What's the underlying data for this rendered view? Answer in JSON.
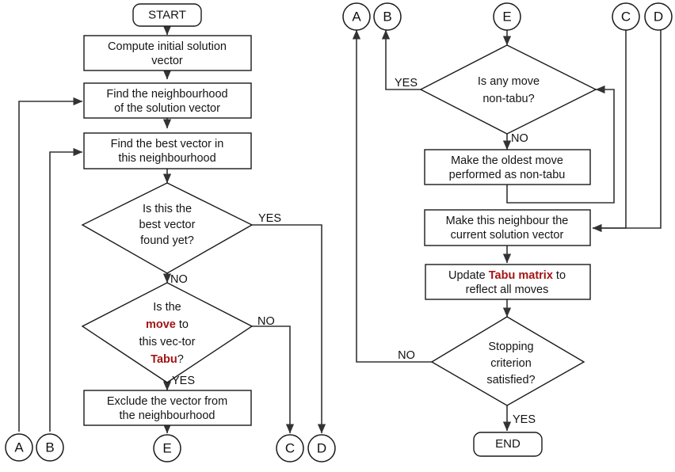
{
  "diagram": {
    "title": "Tabu Search Algorithm Flowchart",
    "accent_color": "#A31515",
    "text_color": "#151515",
    "line_color": "#333333",
    "background": "#ffffff"
  },
  "left_column": {
    "start": {
      "label": "START"
    },
    "compute_initial": {
      "line1": "Compute initial  solution",
      "line2": "vector"
    },
    "find_neighbourhood": {
      "line1": "Find the neighbourhood",
      "line2": "of the  solution vector"
    },
    "find_best_vector": {
      "line1": "Find the best vector in",
      "line2": "this neighbourhood"
    },
    "best_found_decision": {
      "line1": "Is this the",
      "line2": "best vector",
      "line3": "found yet?"
    },
    "tabu_decision": {
      "line1": "Is the",
      "line2_kw": "move",
      "line2_rest": " to",
      "line3": "this vec-tor",
      "line4_kw": "Tabu",
      "line4_rest": "?"
    },
    "exclude_vector": {
      "line1": "Exclude the vector from",
      "line2": "the neighbourhood"
    },
    "labels": {
      "best_yes": "YES",
      "best_no": "NO",
      "tabu_no": "NO",
      "tabu_yes": "YES"
    },
    "connectors_in": [
      {
        "id": "A",
        "label": "A"
      },
      {
        "id": "B",
        "label": "B"
      }
    ],
    "connectors_out": [
      {
        "id": "E",
        "label": "E"
      },
      {
        "id": "C",
        "label": "C"
      },
      {
        "id": "D",
        "label": "D"
      }
    ]
  },
  "right_column": {
    "connectors_in": [
      {
        "id": "E",
        "label": "E"
      },
      {
        "id": "C",
        "label": "C"
      },
      {
        "id": "D",
        "label": "D"
      }
    ],
    "connectors_out": [
      {
        "id": "A",
        "label": "A"
      },
      {
        "id": "B",
        "label": "B"
      }
    ],
    "non_tabu_decision": {
      "line1": "Is any move",
      "line2": "non-tabu?"
    },
    "oldest_move": {
      "line1": "Make the oldest move",
      "line2": "performed as non-tabu"
    },
    "make_neighbour": {
      "line1": "Make this neighbour the",
      "line2": "current solution vector"
    },
    "update_tabu": {
      "line1_pre": "Update ",
      "line1_kw": "Tabu matrix",
      "line1_post": " to",
      "line2": "reflect all moves"
    },
    "stopping_decision": {
      "line1": "Stopping",
      "line2": "criterion",
      "line3": "satisfied?"
    },
    "end": {
      "label": "END"
    },
    "labels": {
      "nontabu_yes": "YES",
      "nontabu_no": "NO",
      "stopping_no": "NO",
      "stopping_yes": "YES"
    }
  },
  "chart_data": {
    "type": "diagram",
    "diagram_kind": "flowchart",
    "nodes": [
      {
        "id": "start",
        "shape": "terminator",
        "text": "START",
        "column": "left"
      },
      {
        "id": "compute_initial",
        "shape": "process",
        "text": "Compute initial solution vector",
        "column": "left"
      },
      {
        "id": "find_neighbourhood",
        "shape": "process",
        "text": "Find the neighbourhood of the solution vector",
        "column": "left"
      },
      {
        "id": "find_best",
        "shape": "process",
        "text": "Find the best vector in this neighbourhood",
        "column": "left"
      },
      {
        "id": "best_found",
        "shape": "decision",
        "text": "Is this the best vector found yet?",
        "column": "left"
      },
      {
        "id": "is_tabu",
        "shape": "decision",
        "text": "Is the move to this vec-tor Tabu?",
        "column": "left"
      },
      {
        "id": "exclude",
        "shape": "process",
        "text": "Exclude the vector from the neighbourhood",
        "column": "left"
      },
      {
        "id": "non_tabu",
        "shape": "decision",
        "text": "Is any move non-tabu?",
        "column": "right"
      },
      {
        "id": "oldest_move",
        "shape": "process",
        "text": "Make the oldest move performed as non-tabu",
        "column": "right"
      },
      {
        "id": "make_neighbour",
        "shape": "process",
        "text": "Make this neighbour the current solution vector",
        "column": "right"
      },
      {
        "id": "update_tabu",
        "shape": "process",
        "text": "Update Tabu matrix to reflect all moves",
        "column": "right"
      },
      {
        "id": "stopping",
        "shape": "decision",
        "text": "Stopping criterion satisfied?",
        "column": "right"
      },
      {
        "id": "end",
        "shape": "terminator",
        "text": "END",
        "column": "right"
      },
      {
        "id": "A",
        "shape": "connector",
        "text": "A"
      },
      {
        "id": "B",
        "shape": "connector",
        "text": "B"
      },
      {
        "id": "C",
        "shape": "connector",
        "text": "C"
      },
      {
        "id": "D",
        "shape": "connector",
        "text": "D"
      },
      {
        "id": "E",
        "shape": "connector",
        "text": "E"
      }
    ],
    "edges": [
      {
        "from": "start",
        "to": "compute_initial",
        "label": ""
      },
      {
        "from": "compute_initial",
        "to": "find_neighbourhood",
        "label": ""
      },
      {
        "from": "find_neighbourhood",
        "to": "find_best",
        "label": ""
      },
      {
        "from": "find_best",
        "to": "best_found",
        "label": ""
      },
      {
        "from": "best_found",
        "to": "D",
        "label": "YES"
      },
      {
        "from": "best_found",
        "to": "is_tabu",
        "label": "NO"
      },
      {
        "from": "is_tabu",
        "to": "C",
        "label": "NO"
      },
      {
        "from": "is_tabu",
        "to": "exclude",
        "label": "YES"
      },
      {
        "from": "exclude",
        "to": "E",
        "label": ""
      },
      {
        "from": "E",
        "to": "non_tabu",
        "label": ""
      },
      {
        "from": "non_tabu",
        "to": "B",
        "label": "YES"
      },
      {
        "from": "non_tabu",
        "to": "oldest_move",
        "label": "NO"
      },
      {
        "from": "oldest_move",
        "to": "non_tabu",
        "label": ""
      },
      {
        "from": "C",
        "to": "make_neighbour",
        "label": ""
      },
      {
        "from": "D",
        "to": "make_neighbour",
        "label": ""
      },
      {
        "from": "make_neighbour",
        "to": "update_tabu",
        "label": ""
      },
      {
        "from": "update_tabu",
        "to": "stopping",
        "label": ""
      },
      {
        "from": "stopping",
        "to": "A",
        "label": "NO"
      },
      {
        "from": "stopping",
        "to": "end",
        "label": "YES"
      },
      {
        "from": "A",
        "to": "find_neighbourhood",
        "label": ""
      },
      {
        "from": "B",
        "to": "find_best",
        "label": ""
      }
    ]
  }
}
